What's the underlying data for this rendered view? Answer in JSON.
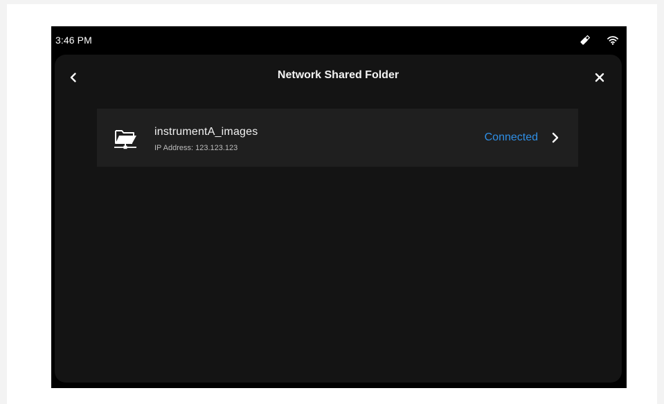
{
  "status_bar": {
    "time": "3:46 PM",
    "icons": [
      "usb-drive-icon",
      "wifi-icon"
    ]
  },
  "header": {
    "title": "Network Shared Folder",
    "back_icon": "chevron-left-icon",
    "close_icon": "close-icon"
  },
  "folders": [
    {
      "name": "instrumentA_images",
      "ip": "IP Address: 123.123.123",
      "status": "Connected",
      "icon": "network-folder-icon"
    }
  ],
  "colors": {
    "background": "#141414",
    "row": "#1f1f1f",
    "accent": "#2f8fe6",
    "text": "#f2f2f2"
  }
}
